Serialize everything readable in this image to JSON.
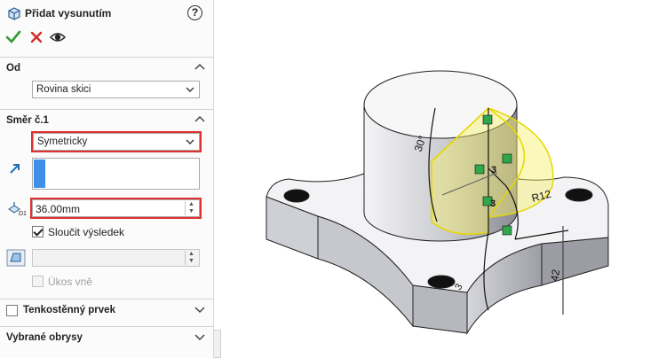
{
  "property_manager": {
    "title": "Přidat vysunutím",
    "icons": {
      "feature": "extrude-boss-icon",
      "help": "help-icon",
      "help_glyph": "?"
    },
    "actions": [
      {
        "name": "ok",
        "icon": "checkmark-icon"
      },
      {
        "name": "cancel",
        "icon": "close-icon"
      },
      {
        "name": "preview",
        "icon": "eye-icon"
      }
    ]
  },
  "from_section": {
    "title": "Od",
    "start_condition": "Rovina skici"
  },
  "direction1_section": {
    "title": "Směr č.1",
    "end_condition": "Symetricky",
    "direction_icon": "arrow-direction-icon",
    "depth_icon": "depth-d1-icon",
    "depth_value": "36.00mm",
    "merge_result_label": "Sloučit výsledek",
    "merge_result_checked": true,
    "draft_icon": "draft-icon",
    "draft_value": "",
    "draft_outward_label": "Úkos vně",
    "draft_outward_checked": false
  },
  "thin_feature_section": {
    "title": "Tenkostěnný prvek",
    "checked": false
  },
  "selected_contours_section": {
    "title": "Vybrané obrysy"
  },
  "model_view": {
    "dimensions": [
      "30°",
      "R12",
      "42",
      "3",
      "3",
      "3"
    ],
    "colors": {
      "preview": "#f2ea3c",
      "model": "#d9dade",
      "highlight": "#e0302f",
      "accent": "#3f8fe8"
    }
  }
}
